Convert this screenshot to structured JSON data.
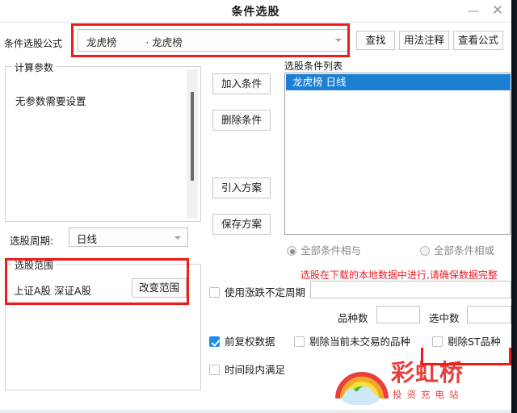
{
  "window": {
    "title": "条件选股",
    "minimize_icon": "minimize-icon",
    "minimize_glyph": "—",
    "close_icon": "close-icon",
    "close_glyph": "✕"
  },
  "formula_row": {
    "label": "条件选股公式",
    "combo_value": "龙虎榜         · 龙虎榜",
    "dropdown_icon": "chevron-down-icon",
    "buttons": [
      {
        "label": "查找"
      },
      {
        "label": "用法注释"
      },
      {
        "label": "查看公式"
      }
    ]
  },
  "calc_params": {
    "group_title": "计算参数",
    "note": "无参数需要设置",
    "scrollbar": "vertical-scrollbar"
  },
  "cycle": {
    "label": "选股周期:",
    "value": "日线",
    "dropdown_icon": "chevron-down-icon"
  },
  "range": {
    "group_title": "选股范围",
    "value": "上证A股 深证A股",
    "change_button": "改变范围"
  },
  "mid_buttons": [
    {
      "label": "加入条件"
    },
    {
      "label": "删除条件"
    },
    {
      "label": "引入方案"
    },
    {
      "label": "保存方案"
    }
  ],
  "condition_list": {
    "label": "选股条件列表",
    "items": [
      {
        "text": "龙虎榜  日线",
        "selected": true
      }
    ]
  },
  "logic_radios": {
    "and_label": "全部条件相与",
    "or_label": "全部条件相或",
    "selected": "and"
  },
  "warning": "选股在下载的本地数据中进行,请确保数据完整",
  "options": {
    "use_updown_period": {
      "label": "使用涨跌不定周期",
      "checked": false
    },
    "period_input_value": "",
    "variety_count_label": "品种数",
    "variety_count_value": "",
    "selected_count_label": "选中数",
    "selected_count_value": "",
    "forward_adjust": {
      "label": "前复权数据",
      "checked": true
    },
    "exclude_untraded": {
      "label": "剔除当前未交易的品种",
      "checked": false
    },
    "exclude_st": {
      "label": "剔除ST品种",
      "checked": false
    },
    "within_timespan": {
      "label": "时间段内满足",
      "checked": false
    }
  },
  "annotations": {
    "highlight_color": "#ee1b18",
    "boxes": [
      "formula-combo",
      "stock-range-group",
      "bottom-right-area"
    ]
  },
  "watermark": {
    "title": "彩虹桥",
    "subtitle": "投资充电站",
    "logo_icon": "rainbow-cloud-logo",
    "color": "#e8403c"
  }
}
